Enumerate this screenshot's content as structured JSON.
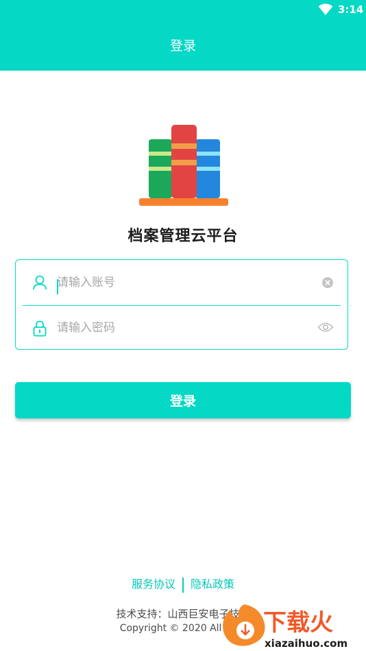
{
  "status_bar": {
    "time": "3:14",
    "wifi_icon": "wifi-icon"
  },
  "header": {
    "title": "登录"
  },
  "app": {
    "name": "档案管理云平台",
    "logo_icon": "books-icon"
  },
  "form": {
    "account": {
      "placeholder": "请输入账号",
      "value": "",
      "icon": "user-icon",
      "trailing_icon": "clear-icon"
    },
    "password": {
      "placeholder": "请输入密码",
      "value": "",
      "icon": "lock-icon",
      "trailing_icon": "eye-icon"
    }
  },
  "login_button": {
    "label": "登录"
  },
  "links": {
    "service_agreement": "服务协议",
    "privacy_policy": "隐私政策"
  },
  "footer": {
    "support": "技术支持：山西巨安电子技术",
    "copyright": "Copyright © 2020 All Righ"
  },
  "watermark": {
    "brand": "下载火",
    "site": "xiazaihuo.com"
  },
  "colors": {
    "accent": "#05d8c5",
    "text_dark": "#1c1c1c",
    "placeholder": "#a7a7a7"
  }
}
